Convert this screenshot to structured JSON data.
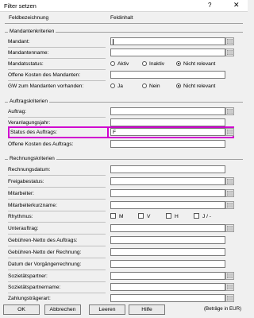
{
  "window": {
    "title": "Filter setzen",
    "help": "?",
    "close": "✕"
  },
  "header": {
    "col_field": "Feldbezeichnung",
    "col_content": "Feldinhalt"
  },
  "groups": {
    "mandanten": "Mandantenkriterien",
    "auftrag": "Auftragskriterien",
    "rechnung": "Rechnungskriterien"
  },
  "fields": {
    "mandant": "Mandant:",
    "mandantenname": "Mandantenname:",
    "mandatsstatus": "Mandatsstatus:",
    "offene_kosten_mandanten": "Offene Kosten des Mandanten:",
    "gw_mandanten": "GW zum Mandanten vorhanden:",
    "auftrag": "Auftrag:",
    "veranlagungsjahr": "Veranlagungsjahr:",
    "status_auftrag": "Status des Auftrags:",
    "status_auftrag_value": "F",
    "offene_kosten_auftrag": "Offene Kosten des Auftrags:",
    "rechnungsdatum": "Rechnungsdatum:",
    "freigabestatus": "Freigabestatus:",
    "mitarbeiter": "Mitarbeiter:",
    "mitarbeiterkurzname": "Mitarbeiterkurzname:",
    "rhythmus": "Rhythmus:",
    "unterauftrag": "Unterauftrag:",
    "gebuehren_auftrag": "Gebühren-Netto des Auftrags:",
    "gebuehren_rechnung": "Gebühren-Netto der Rechnung:",
    "datum_vorgaenger": "Datum der Vorgängerrechnung:",
    "sozietaetspartner": "Sozietätspartner:",
    "sozietaetspartnername": "Sozietätspartnername:",
    "zahlungstraeger": "Zahlungsträgerart:"
  },
  "radios": {
    "status": [
      {
        "label": "Aktiv",
        "selected": false
      },
      {
        "label": "Inaktiv",
        "selected": false
      },
      {
        "label": "Nicht relevant",
        "selected": true
      }
    ],
    "gw": [
      {
        "label": "Ja",
        "selected": false
      },
      {
        "label": "Nein",
        "selected": false
      },
      {
        "label": "Nicht relevant",
        "selected": true
      }
    ]
  },
  "rhythmus": [
    "M",
    "V",
    "H",
    "J / -"
  ],
  "buttons": {
    "ok": "OK",
    "cancel": "Abbrechen",
    "clear": "Leeren",
    "help": "Hilfe"
  },
  "note": "(Beträge in EUR)",
  "colors": {
    "highlight": "#d000d0"
  }
}
